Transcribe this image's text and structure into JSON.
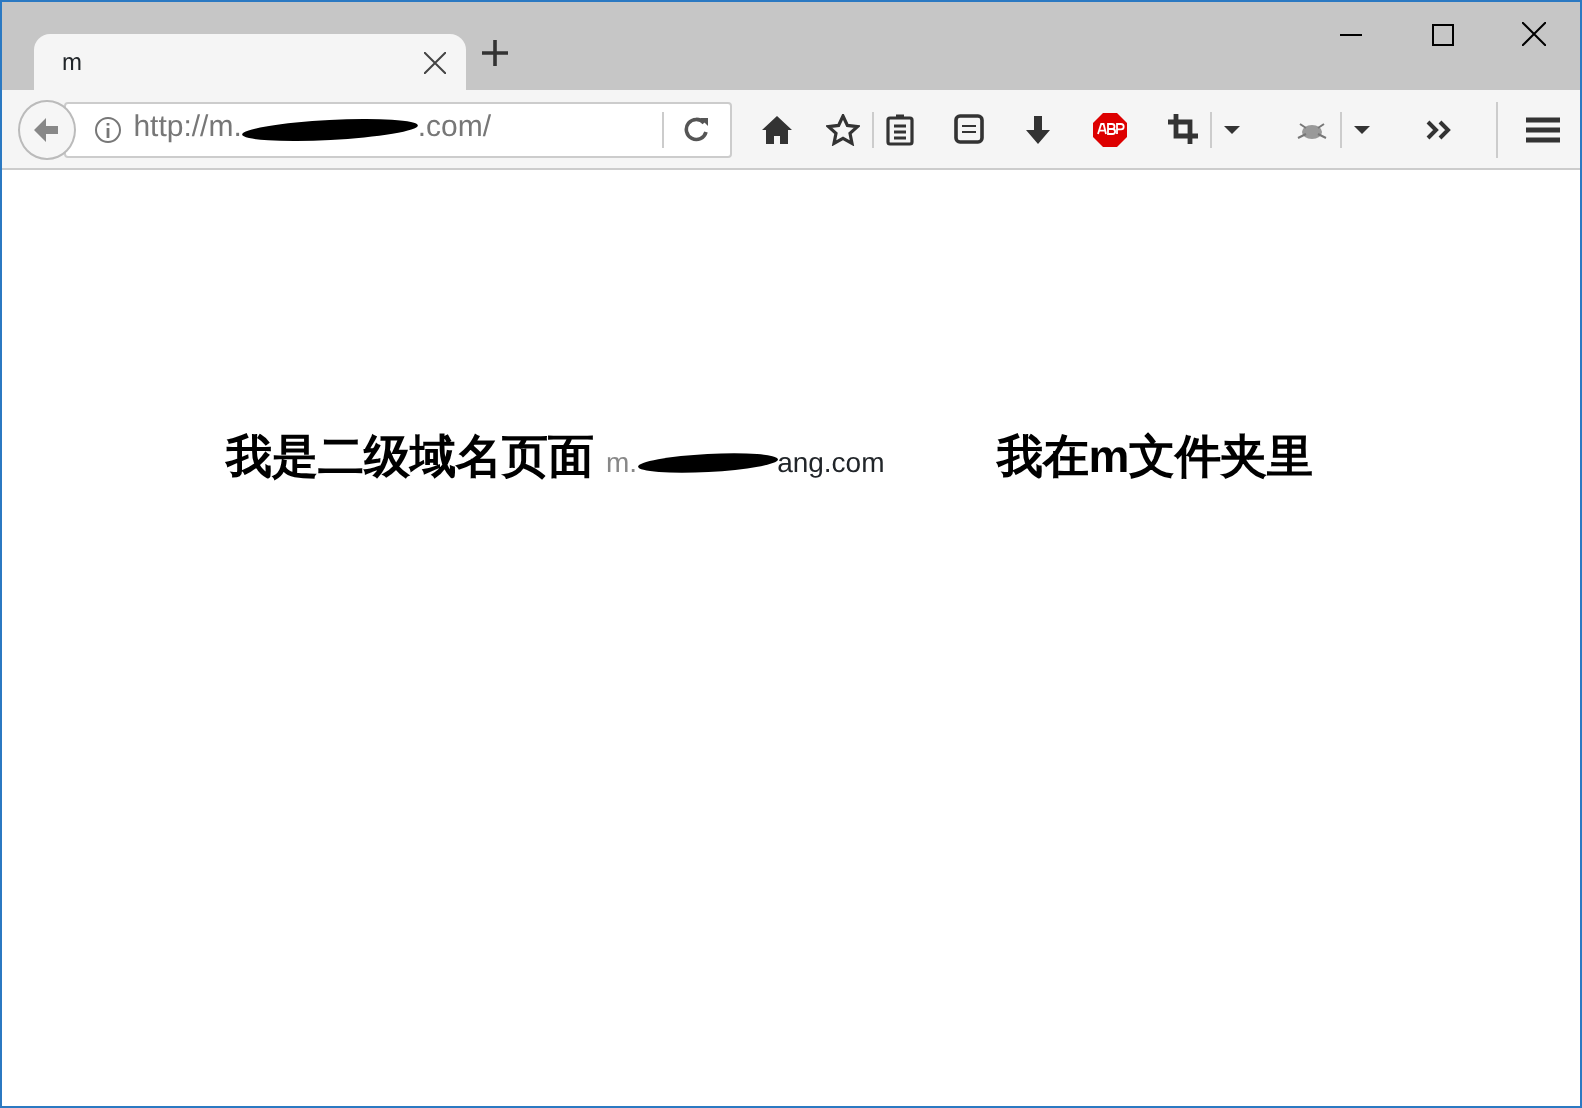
{
  "tabs": [
    {
      "label": "m",
      "selected": true
    }
  ],
  "address_bar": {
    "url_start": "http://m.",
    "url_end": ".com/"
  },
  "page": {
    "heading": "我是二级域名页面",
    "domain_start": "m.",
    "domain_end": "ang.com",
    "folder_note": "我在m文件夹里"
  }
}
